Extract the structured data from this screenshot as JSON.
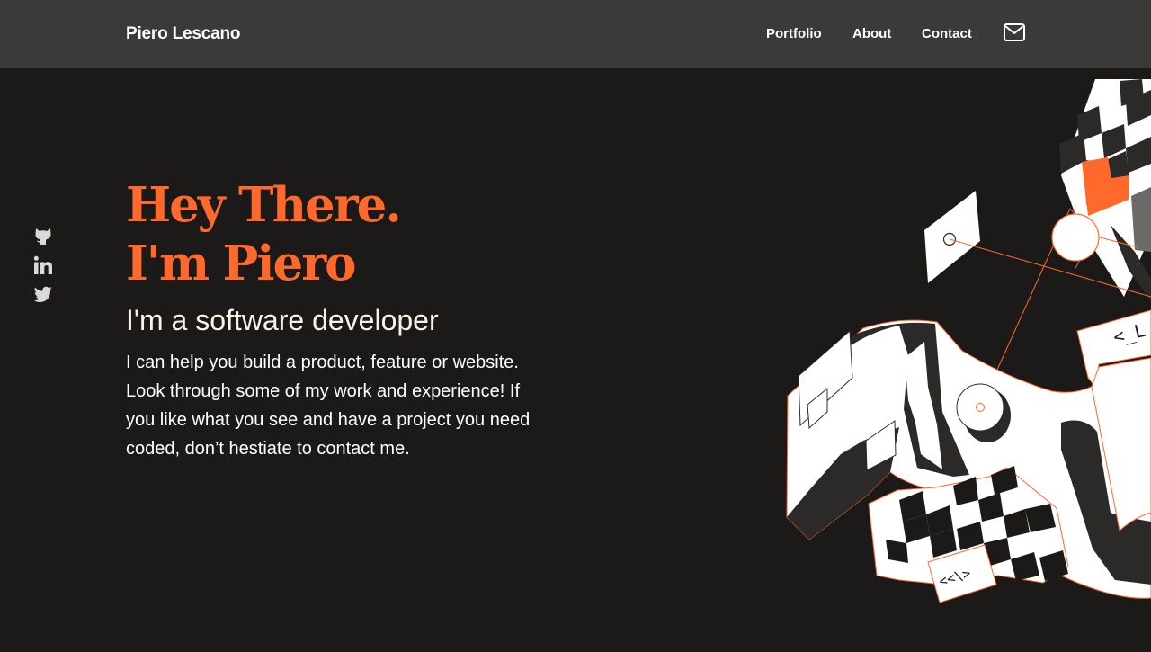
{
  "header": {
    "brand": "Piero Lescano",
    "nav": {
      "portfolio": "Portfolio",
      "about": "About",
      "contact": "Contact"
    },
    "mail_icon": "mail-icon"
  },
  "social": {
    "icons": [
      "github-icon",
      "linkedin-icon",
      "twitter-icon"
    ]
  },
  "hero": {
    "headline_line1": "Hey There.",
    "headline_line2": "I'm Piero",
    "subtitle": "I'm a software developer",
    "bio_lines": [
      "I can help you build a product, feature or website.",
      "Look through some of my work and experience! If",
      "you like what you see and have a project you need",
      "coded, don’t hestiate to contact me."
    ]
  },
  "illustration": {
    "code_tag_top": "<_L",
    "code_tag_bottom": "<<\\>"
  },
  "colors": {
    "background": "#1c1a19",
    "header": "#3b3a39",
    "accent": "#ff6a2c",
    "text": "#ffffff",
    "subtitle": "#fbf1e4",
    "icon": "#d9d9d9"
  }
}
